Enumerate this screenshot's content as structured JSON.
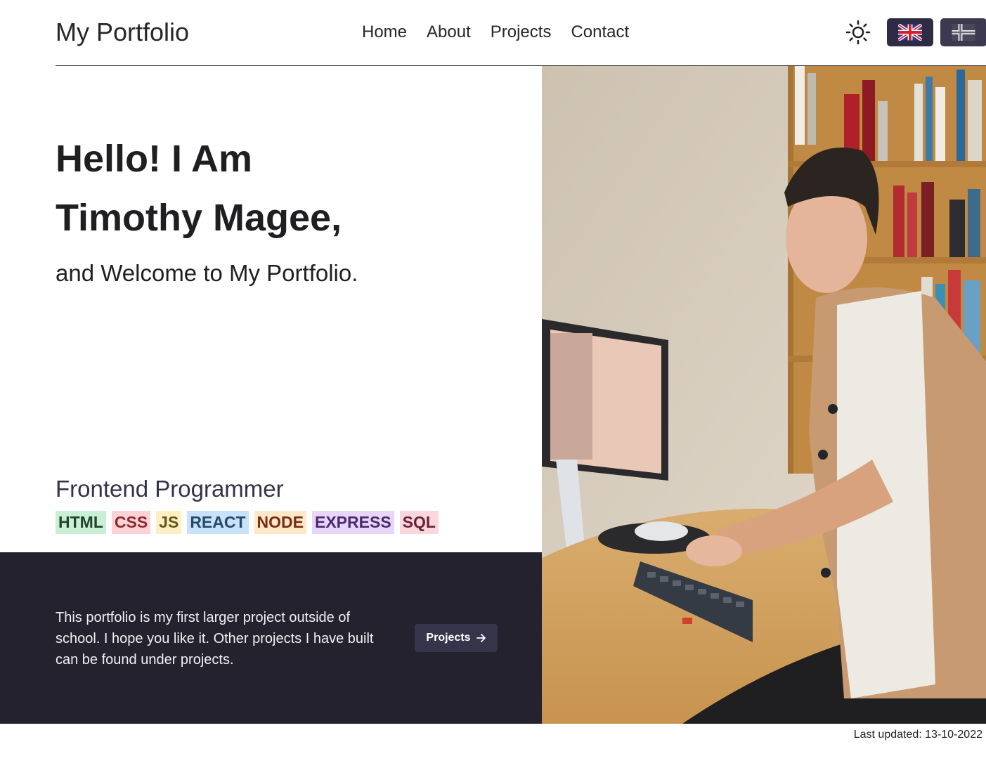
{
  "header": {
    "brand": "My Portfolio",
    "nav": [
      "Home",
      "About",
      "Projects",
      "Contact"
    ],
    "theme_icon": "sun-icon",
    "lang_en_icon": "uk-flag-icon",
    "lang_no_icon": "norway-flag-icon"
  },
  "hero": {
    "greeting_line1": "Hello! I Am",
    "greeting_line2": "Timothy Magee,",
    "welcome": "and Welcome to My Portfolio.",
    "role": "Frontend Programmer",
    "tags": [
      {
        "label": "HTML",
        "bg": "#c9efd5",
        "fg": "#24432e"
      },
      {
        "label": "CSS",
        "bg": "#fbd3d6",
        "fg": "#8b2a30"
      },
      {
        "label": "JS",
        "bg": "#fcefc3",
        "fg": "#6b5416"
      },
      {
        "label": "REACT",
        "bg": "#c8e2f8",
        "fg": "#254a6c"
      },
      {
        "label": "NODE",
        "bg": "#fde8c9",
        "fg": "#7a2c12"
      },
      {
        "label": "EXPRESS",
        "bg": "#e7d6f7",
        "fg": "#4b2a70"
      },
      {
        "label": "SQL",
        "bg": "#fad7de",
        "fg": "#6a2236"
      }
    ]
  },
  "band": {
    "text": "This portfolio is my first larger project outside of school. I hope you like it. Other projects I have built can be found under projects.",
    "button_label": "Projects",
    "button_icon": "arrow-right-icon"
  },
  "footer": {
    "last_updated": "Last updated: 13-10-2022"
  },
  "colors": {
    "dark_band": "#23222e",
    "button": "#35344a",
    "lang_button": "#2e2b45"
  }
}
